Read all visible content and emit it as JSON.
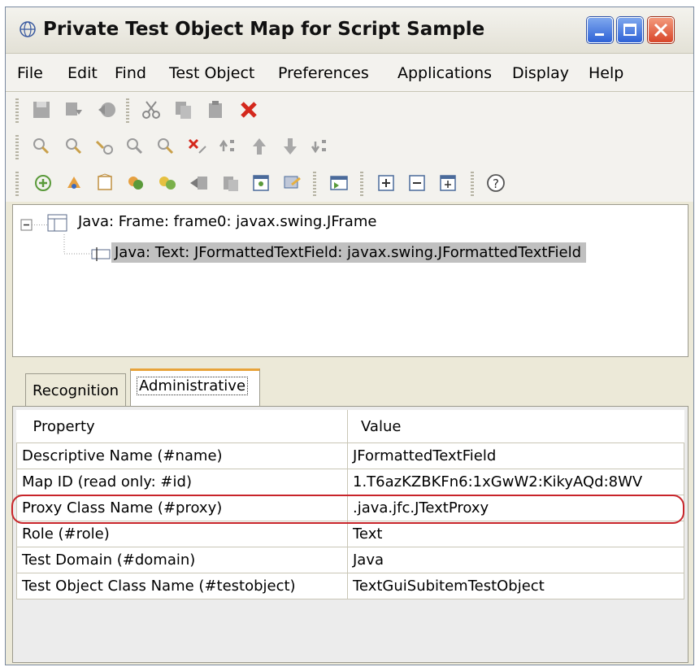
{
  "window": {
    "title": "Private Test Object Map for Script Sample",
    "accent": "#2e62d6",
    "close_color": "#d8462a"
  },
  "menu": [
    {
      "label": "File"
    },
    {
      "label": "Edit"
    },
    {
      "label": "Find"
    },
    {
      "label": "Test Object"
    },
    {
      "label": "Preferences"
    },
    {
      "label": "Applications"
    },
    {
      "label": "Display"
    },
    {
      "label": "Help"
    }
  ],
  "toolbars": {
    "row1": [
      "save-icon",
      "insert-icon",
      "back-icon",
      "cut-icon",
      "copy-icon",
      "paste-icon",
      "delete-icon"
    ],
    "row2": [
      "find-icon",
      "find-next-icon",
      "find-mapped-icon",
      "search-object-icon",
      "search-properties-icon",
      "clear-find-icon",
      "move-top-icon",
      "move-up-icon",
      "move-down-icon",
      "move-bottom-icon"
    ],
    "row3": [
      "add-object-icon",
      "insert-object-icon",
      "new-object-icon",
      "merge-icon",
      "unify-icon",
      "export-icon",
      "import-icon",
      "highlight-icon",
      "update-icon",
      "open-script-icon",
      "expand-all-icon",
      "collapse-all-icon",
      "expand-selected-icon",
      "help-icon"
    ]
  },
  "tree": {
    "root": "Java: Frame: frame0: javax.swing.JFrame",
    "child": "Java: Text: JFormattedTextField: javax.swing.JFormattedTextField"
  },
  "tabs": {
    "recognition": "Recognition",
    "administrative": "Administrative"
  },
  "table": {
    "headers": {
      "property": "Property",
      "value": "Value"
    },
    "rows": [
      {
        "property": "Descriptive Name (#name)",
        "value": "JFormattedTextField"
      },
      {
        "property": "Map ID (read only: #id)",
        "value": "1.T6azKZBKFn6:1xGwW2:KikyAQd:8WV"
      },
      {
        "property": "Proxy Class Name (#proxy)",
        "value": ".java.jfc.JTextProxy"
      },
      {
        "property": "Role (#role)",
        "value": "Text"
      },
      {
        "property": "Test Domain (#domain)",
        "value": "Java"
      },
      {
        "property": "Test Object Class Name (#testobject)",
        "value": "TextGuiSubitemTestObject"
      }
    ],
    "highlight_color": "#c8242a"
  }
}
